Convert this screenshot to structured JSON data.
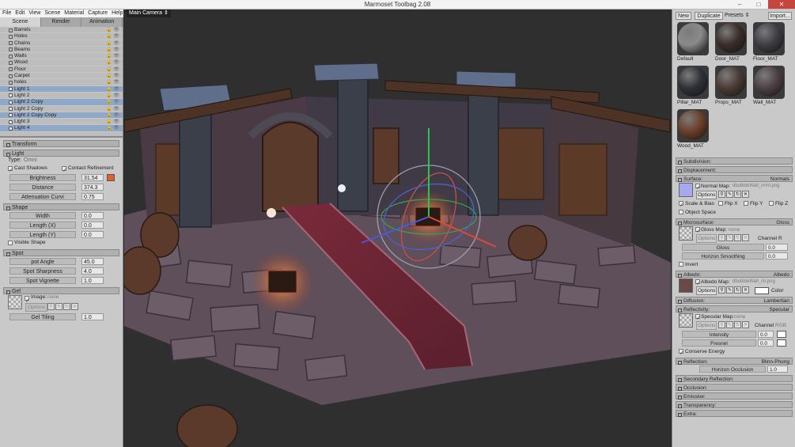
{
  "window": {
    "title": "Marmoset Toolbag 2.08",
    "minimize": "–",
    "maximize": "□",
    "close": "✕"
  },
  "menu": [
    "File",
    "Edit",
    "View",
    "Scene",
    "Material",
    "Capture",
    "Help"
  ],
  "left_tabs": {
    "scene": "Scene",
    "render": "Render",
    "animation": "Animation"
  },
  "outliner": [
    {
      "label": "Barrels",
      "type": "mesh"
    },
    {
      "label": "Holes",
      "type": "mesh"
    },
    {
      "label": "Chains",
      "type": "mesh"
    },
    {
      "label": "Beams",
      "type": "mesh"
    },
    {
      "label": "Walls",
      "type": "mesh"
    },
    {
      "label": "Wood",
      "type": "mesh"
    },
    {
      "label": "Floor",
      "type": "mesh"
    },
    {
      "label": "Carpet",
      "type": "mesh"
    },
    {
      "label": "holes",
      "type": "mesh"
    },
    {
      "label": "Light 1",
      "type": "light"
    },
    {
      "label": "Light 2",
      "type": "light"
    },
    {
      "label": "Light 2 Copy",
      "type": "light"
    },
    {
      "label": "Light 2 Copy",
      "type": "light"
    },
    {
      "label": "Light 2 Copy Copy",
      "type": "light"
    },
    {
      "label": "Light 3",
      "type": "light"
    },
    {
      "label": "Light 4",
      "type": "light"
    }
  ],
  "props": {
    "transform": "Transform",
    "light": "Light",
    "type_label": "Type:",
    "type_value": "Omni",
    "cast_shadows": "Cast Shadows",
    "contact_refinement": "Contact Refinement",
    "brightness": "Brightness",
    "brightness_value": "31.54",
    "light_color": "#e0602a",
    "distance": "Distance",
    "distance_value": "374.3",
    "attenuation": "Attenuation Curvi",
    "attenuation_value": "0.75",
    "shape": "Shape",
    "width": "Width",
    "width_value": "0.0",
    "length_x": "Length (X)",
    "length_x_value": "0.0",
    "length_y": "Length (Y)",
    "length_y_value": "0.0",
    "visible_shape": "Visible Shape",
    "spot": "Spot",
    "spot_angle": "pot Angle",
    "spot_angle_value": "45.0",
    "spot_sharpness": "Spot Sharpness",
    "spot_sharpness_value": "4.0",
    "spot_vignette": "Spot Vignette",
    "spot_vignette_value": "1.0",
    "gel": "Gel",
    "gel_image": "Image:",
    "gel_image_value": "none",
    "gel_options": "Options",
    "gel_tiling": "Gel Tiling",
    "gel_tiling_value": "1.0"
  },
  "viewport": {
    "camera": "Main Camera ⇕"
  },
  "materials_toolbar": {
    "new": "New",
    "duplicate": "Duplicate",
    "presets": "Presets ⇕",
    "import": "Import..."
  },
  "materials": [
    {
      "name": "Default",
      "color": "#8a8a8a"
    },
    {
      "name": "Door_MAT",
      "color": "#3a2d2a"
    },
    {
      "name": "Floor_MAT",
      "color": "#3d3d45"
    },
    {
      "name": "Pillar_MAT",
      "color": "#2e3138"
    },
    {
      "name": "Props_MAT",
      "color": "#4a3b35"
    },
    {
      "name": "Wall_MAT",
      "color": "#4d4044"
    },
    {
      "name": "Wood_MAT",
      "color": "#6b3f28"
    }
  ],
  "material_panel": {
    "subdivision": "Subdivision:",
    "displacement": "Displacement:",
    "surface": "Surface:",
    "surface_value": "Normals",
    "normal_map": "Normal Map:",
    "normal_map_file": "dbubbleWall_nrml.png",
    "options": "Options",
    "scale_bias": "Scale & Bias",
    "flip_x": "Flip X",
    "flip_y": "Flip Y",
    "flip_z": "Flip Z",
    "object_space": "Object Space",
    "microsurface": "Microsurface:",
    "microsurface_value": "Gloss",
    "gloss_map": "Gloss Map:",
    "gloss_map_file": "none",
    "channel": "Channel",
    "channel_r": "R",
    "gloss": "Gloss",
    "gloss_value": "0.0",
    "horizon_smoothing": "Horizon Smoothing",
    "horizon_smoothing_value": "0.0",
    "invert": "Invert",
    "albedo": "Albedo:",
    "albedo_value": "Albedo",
    "albedo_map": "Albedo Map:",
    "albedo_map_file": "dbubbleWall_clr.png",
    "color": "Color",
    "diffusion": "Diffusion:",
    "diffusion_value": "Lambertian",
    "reflectivity": "Reflectivity:",
    "reflectivity_value": "Specular",
    "specular_map": "Specular Map:",
    "specular_map_file": "none",
    "channel_rgb": "RGB",
    "intensity": "Intensity",
    "intensity_value": "0.0",
    "fresnel": "Fresnel",
    "fresnel_value": "0.0",
    "conserve_energy": "Conserve Energy",
    "reflection": "Reflection:",
    "reflection_value": "Blinn-Phong",
    "horizon_occlusion": "Horizon  Occlusion",
    "horizon_occlusion_value": "1.0",
    "secondary_reflection": "Secondary Reflection:",
    "occlusion": "Occlusion:",
    "emissive": "Emissive:",
    "transparency": "Transparency:",
    "extra": "Extra:"
  }
}
